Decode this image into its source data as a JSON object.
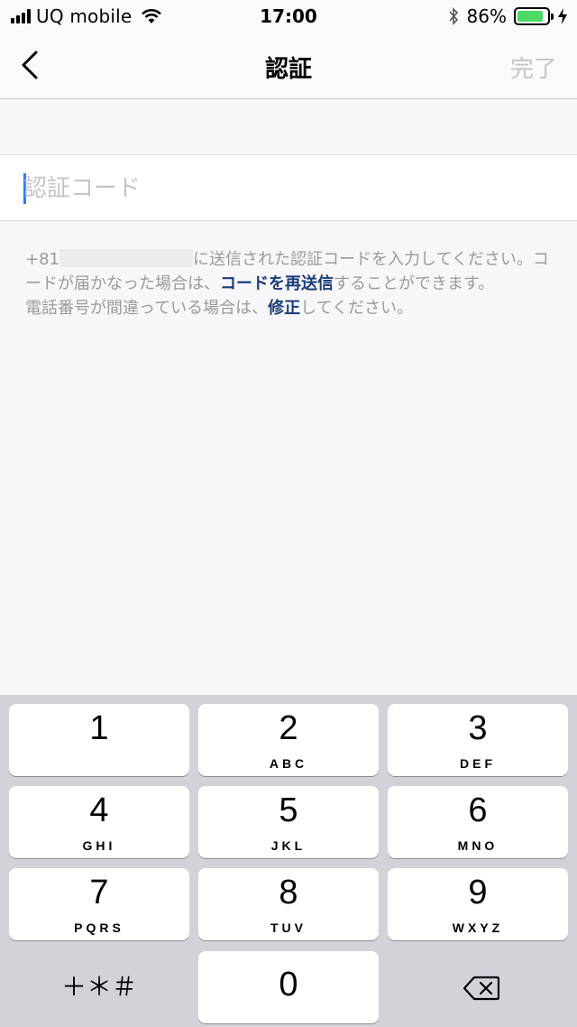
{
  "status": {
    "carrier": "UQ mobile",
    "time": "17:00",
    "battery_percent": "86%",
    "battery_level": 0.86
  },
  "nav": {
    "title": "認証",
    "done_label": "完了"
  },
  "input": {
    "placeholder": "認証コード"
  },
  "description": {
    "prefix": "+81",
    "text1": "に送信された認証コードを入力してください。コードが届かなった場合は、",
    "resend_link": "コードを再送信",
    "text2": "することができます。",
    "text3": "電話番号が間違っている場合は、",
    "fix_link": "修正",
    "text4": "してください。"
  },
  "keypad": {
    "keys": [
      {
        "num": "1",
        "letters": ""
      },
      {
        "num": "2",
        "letters": "ABC"
      },
      {
        "num": "3",
        "letters": "DEF"
      },
      {
        "num": "4",
        "letters": "GHI"
      },
      {
        "num": "5",
        "letters": "JKL"
      },
      {
        "num": "6",
        "letters": "MNO"
      },
      {
        "num": "7",
        "letters": "PQRS"
      },
      {
        "num": "8",
        "letters": "TUV"
      },
      {
        "num": "9",
        "letters": "WXYZ"
      },
      {
        "num": "0",
        "letters": ""
      }
    ],
    "symbols_label": "＋＊＃"
  },
  "colors": {
    "accent": "#3478f6",
    "link": "#1c3c78",
    "battery": "#4cd964"
  },
  "icons": {
    "back": "chevron-left-icon",
    "delete": "backspace-icon",
    "wifi": "wifi-icon",
    "bluetooth": "bluetooth-icon",
    "charging": "bolt-icon"
  }
}
